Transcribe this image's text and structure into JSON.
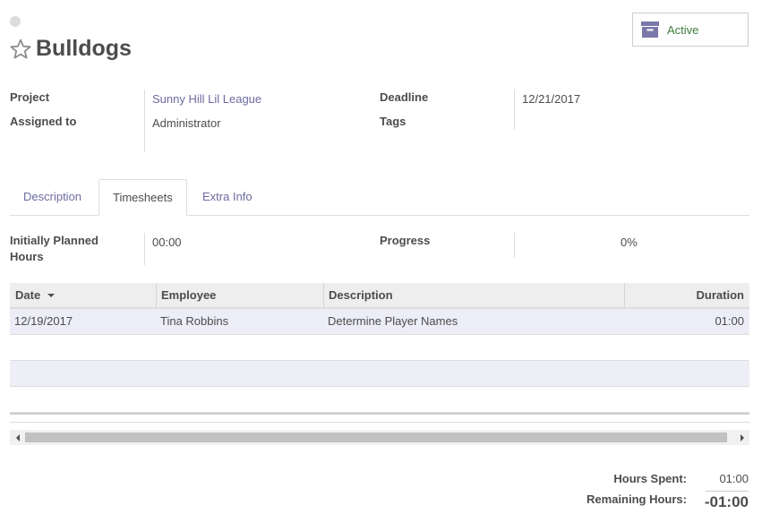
{
  "record": {
    "title": "Bulldogs"
  },
  "status_button": {
    "label": "Active"
  },
  "fields": {
    "project_label": "Project",
    "project_value": "Sunny Hill Lil League",
    "assigned_label": "Assigned to",
    "assigned_value": "Administrator",
    "deadline_label": "Deadline",
    "deadline_value": "12/21/2017",
    "tags_label": "Tags"
  },
  "tabs": [
    {
      "label": "Description"
    },
    {
      "label": "Timesheets"
    },
    {
      "label": "Extra Info"
    }
  ],
  "timesheets": {
    "planned_label_1": "Initially Planned",
    "planned_label_2": "Hours",
    "planned_value": "00:00",
    "progress_label": "Progress",
    "progress_value": "0%",
    "columns": {
      "date": "Date",
      "employee": "Employee",
      "description": "Description",
      "duration": "Duration"
    },
    "rows": [
      {
        "date": "12/19/2017",
        "employee": "Tina Robbins",
        "description": "Determine Player Names",
        "duration": "01:00"
      }
    ],
    "hours_spent_label": "Hours Spent:",
    "hours_spent_value": "01:00",
    "remaining_label": "Remaining Hours:",
    "remaining_value": "-01:00"
  },
  "colors": {
    "link": "#6e6ba1",
    "active_text": "#3e7c3c",
    "archive_icon": "#7a78a8"
  }
}
